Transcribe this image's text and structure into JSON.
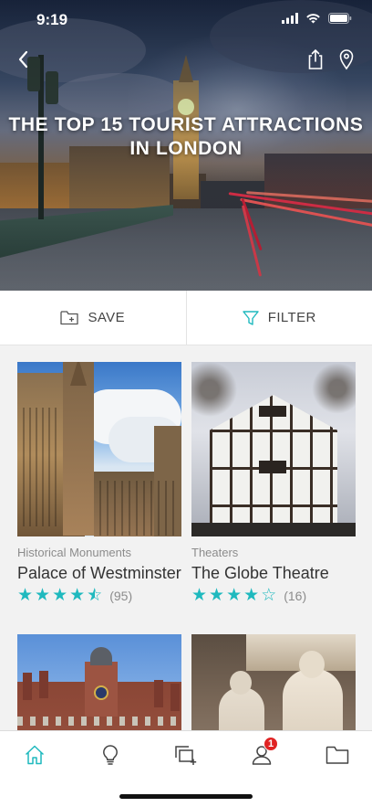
{
  "status_bar": {
    "time": "9:19"
  },
  "hero": {
    "title": "THE TOP 15 TOURIST ATTRACTIONS IN LONDON"
  },
  "actions": {
    "save_label": "SAVE",
    "filter_label": "FILTER"
  },
  "cards": [
    {
      "category": "Historical Monuments",
      "name": "Palace of Westminster",
      "rating": 4.5,
      "review_count": "(95)"
    },
    {
      "category": "Theaters",
      "name": "The Globe Theatre",
      "rating": 4,
      "review_count": "(16)"
    },
    {
      "category": "",
      "name": "",
      "rating": null,
      "review_count": ""
    },
    {
      "category": "",
      "name": "",
      "rating": null,
      "review_count": ""
    }
  ],
  "tab_bar": {
    "items": [
      {
        "icon": "home-icon",
        "active": true
      },
      {
        "icon": "lightbulb-icon",
        "active": false
      },
      {
        "icon": "add-collection-icon",
        "active": false
      },
      {
        "icon": "profile-icon",
        "active": false,
        "badge": "1"
      },
      {
        "icon": "folder-icon",
        "active": false
      }
    ]
  },
  "colors": {
    "accent": "#1fb9be",
    "badge": "#e02323",
    "text": "#333333",
    "muted": "#8c8c8c"
  }
}
